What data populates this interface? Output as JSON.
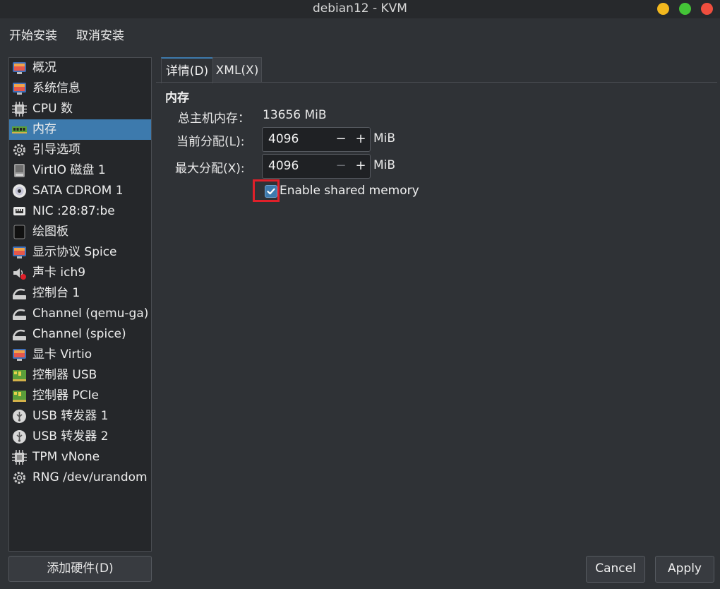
{
  "window": {
    "title": "debian12 - KVM"
  },
  "menu": {
    "begin_install": "开始安装",
    "cancel_install": "取消安装"
  },
  "sidebar": {
    "items": [
      {
        "label": "概况",
        "icon": "monitor-icon"
      },
      {
        "label": "系统信息",
        "icon": "monitor-icon"
      },
      {
        "label": "CPU 数",
        "icon": "cpu-icon"
      },
      {
        "label": "内存",
        "icon": "memory-icon"
      },
      {
        "label": "引导选项",
        "icon": "gear-icon"
      },
      {
        "label": "VirtIO 磁盘 1",
        "icon": "disk-icon"
      },
      {
        "label": "SATA CDROM 1",
        "icon": "cdrom-icon"
      },
      {
        "label": "NIC :28:87:be",
        "icon": "network-icon"
      },
      {
        "label": "绘图板",
        "icon": "tablet-icon"
      },
      {
        "label": "显示协议 Spice",
        "icon": "monitor-icon"
      },
      {
        "label": "声卡 ich9",
        "icon": "speaker-icon"
      },
      {
        "label": "控制台 1",
        "icon": "serial-icon"
      },
      {
        "label": "Channel (qemu-ga)",
        "icon": "serial-icon"
      },
      {
        "label": "Channel (spice)",
        "icon": "serial-icon"
      },
      {
        "label": "显卡 Virtio",
        "icon": "monitor-icon"
      },
      {
        "label": "控制器 USB",
        "icon": "controller-icon"
      },
      {
        "label": "控制器 PCIe",
        "icon": "controller-icon"
      },
      {
        "label": "USB 转发器 1",
        "icon": "usb-icon"
      },
      {
        "label": "USB 转发器 2",
        "icon": "usb-icon"
      },
      {
        "label": "TPM vNone",
        "icon": "cpu-icon"
      },
      {
        "label": "RNG /dev/urandom",
        "icon": "gear-icon"
      }
    ],
    "selected_index": 3,
    "add_hardware": "添加硬件(D)"
  },
  "tabs": {
    "details": "详情(D)",
    "xml": "XML(X)"
  },
  "memory": {
    "section_title": "内存",
    "total_label": "总主机内存：",
    "total_value": "13656 MiB",
    "current_label": "当前分配(L):",
    "current_value": "4096",
    "max_label": "最大分配(X):",
    "max_value": "4096",
    "unit": "MiB",
    "minus": "−",
    "plus": "+",
    "shared_label": "Enable shared memory",
    "shared_checked": true
  },
  "buttons": {
    "cancel": "Cancel",
    "apply": "Apply"
  },
  "colors": {
    "accent": "#3d7aad",
    "highlight": "#e0202a"
  }
}
